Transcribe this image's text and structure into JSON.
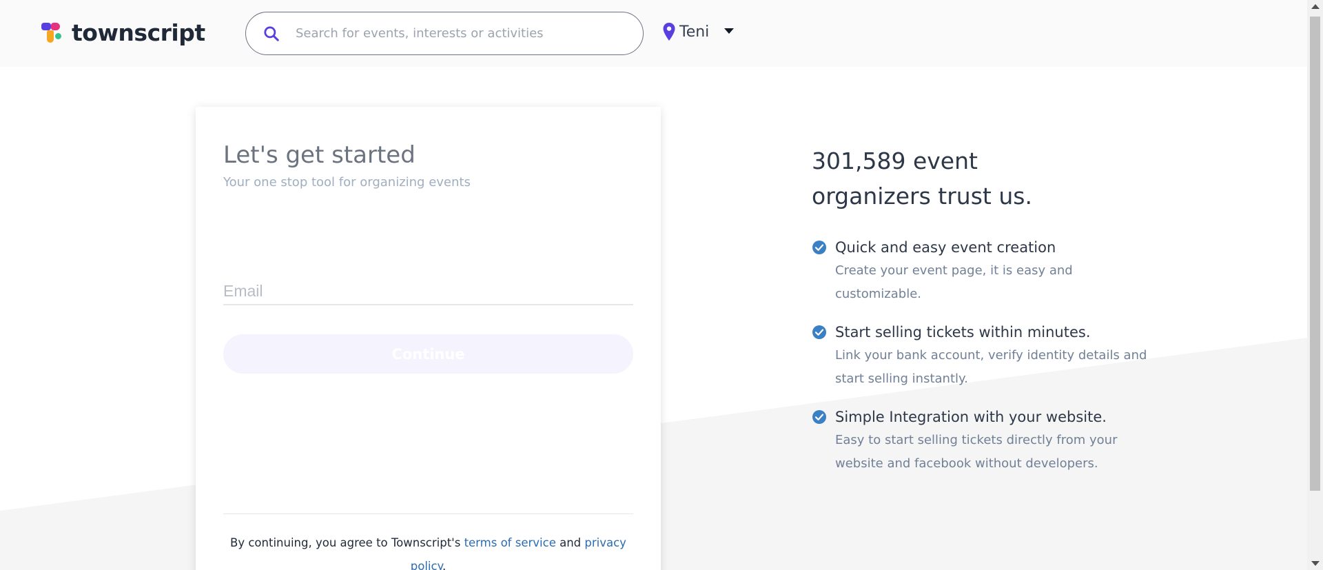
{
  "header": {
    "logo_text": "townscript",
    "search": {
      "placeholder": "Search for events, interests or activities"
    },
    "location": {
      "city": "Teni"
    }
  },
  "card": {
    "title": "Let's get started",
    "subtitle": "Your one stop tool for organizing events",
    "email": {
      "placeholder": "Email"
    },
    "continue_label": "Continue",
    "terms": {
      "prefix": "By continuing, you agree to Townscript's ",
      "tos_link": "terms of service",
      "middle": " and ",
      "privacy_link": "privacy policy",
      "suffix": "."
    }
  },
  "trust": {
    "title": "301,589 event organizers trust us.",
    "features": [
      {
        "title": "Quick and easy event creation",
        "desc": "Create your event page, it is easy and customizable."
      },
      {
        "title": "Start selling tickets within minutes.",
        "desc": "Link your bank account, verify identity details and start selling instantly."
      },
      {
        "title": "Simple Integration with your website.",
        "desc": "Easy to start selling tickets directly from your website and facebook without developers."
      }
    ]
  },
  "colors": {
    "accent": "#5a3fe0",
    "link": "#2b6cb0",
    "check": "#3b7fc4",
    "button_disabled_bg": "#f5f3fe"
  },
  "icons": {
    "logo": "townscript-logo-icon",
    "search": "search-icon",
    "location": "location-pin-icon",
    "dropdown": "caret-down-icon",
    "feature": "check-circle-icon"
  }
}
